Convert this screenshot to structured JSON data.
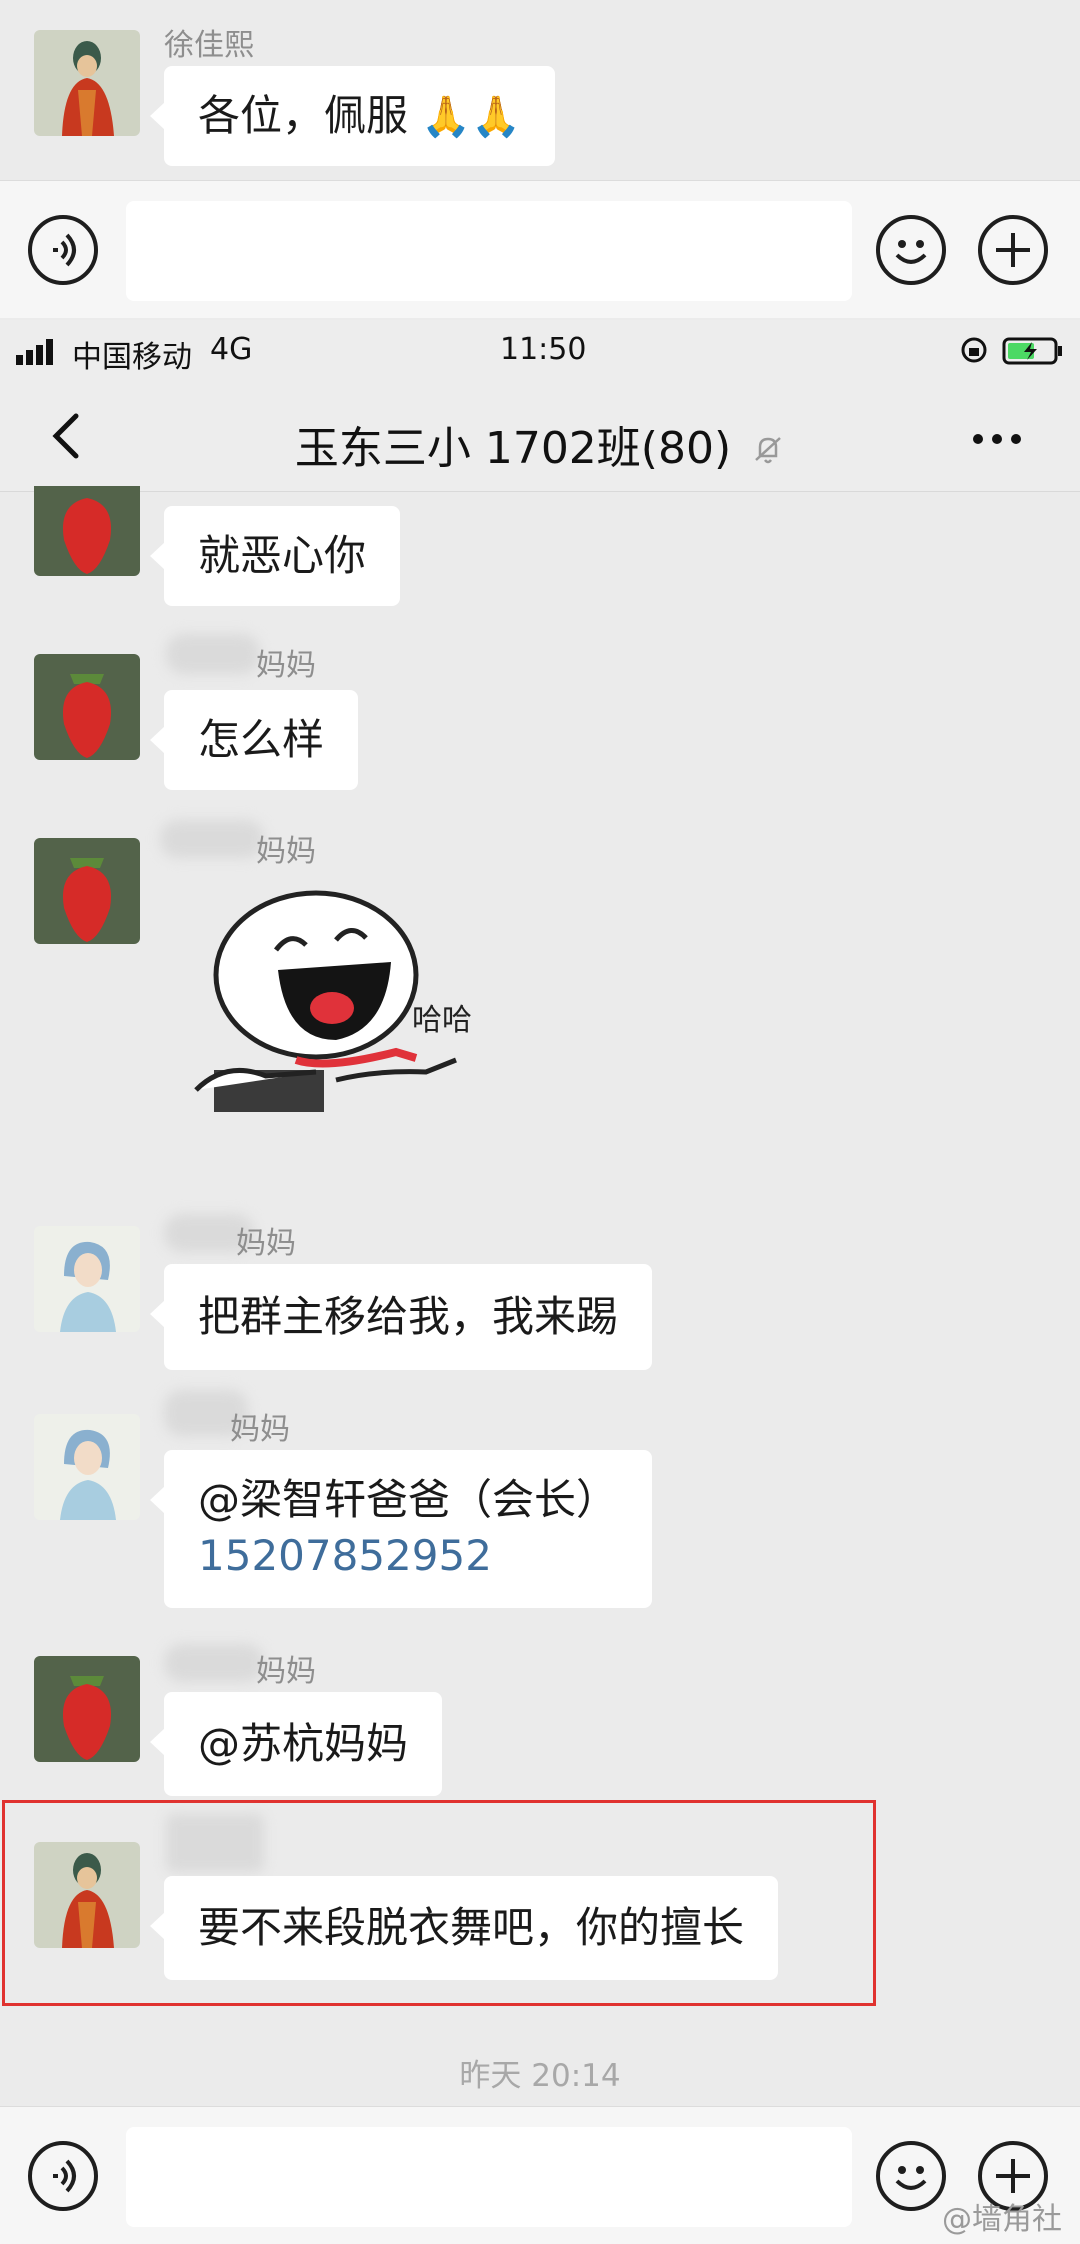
{
  "top_snippet": {
    "sender": "徐佳熙",
    "message": "各位，佩服"
  },
  "status_bar": {
    "carrier": "中国移动",
    "network": "4G",
    "time": "11:50"
  },
  "nav": {
    "title": "玉东三小 1702班(80)"
  },
  "messages": [
    {
      "sender_visible": "",
      "text": "就恶心你"
    },
    {
      "sender_visible": "妈妈",
      "text": "怎么样"
    },
    {
      "sender_visible": "妈妈",
      "sticker_text": "哈哈"
    },
    {
      "sender_visible": "妈妈",
      "text": "把群主移给我，我来踢"
    },
    {
      "sender_visible": "妈妈",
      "text_line1": "@梁智轩爸爸（会长）",
      "text_line2": "15207852952"
    },
    {
      "sender_visible": "妈妈",
      "text": "@苏杭妈妈"
    },
    {
      "sender_visible": "",
      "text": "要不来段脱衣舞吧，你的擅长"
    }
  ],
  "time_separator": "昨天 20:14",
  "watermark": "@墙角社",
  "colors": {
    "background": "#ebebeb",
    "bubble": "#ffffff",
    "highlight_border": "#e0322f",
    "link": "#3f6d9b"
  },
  "icons": [
    "voice-icon",
    "emoji-icon",
    "plus-icon",
    "back-icon",
    "mute-bell-icon",
    "more-icon",
    "signal-icon",
    "battery-icon"
  ]
}
